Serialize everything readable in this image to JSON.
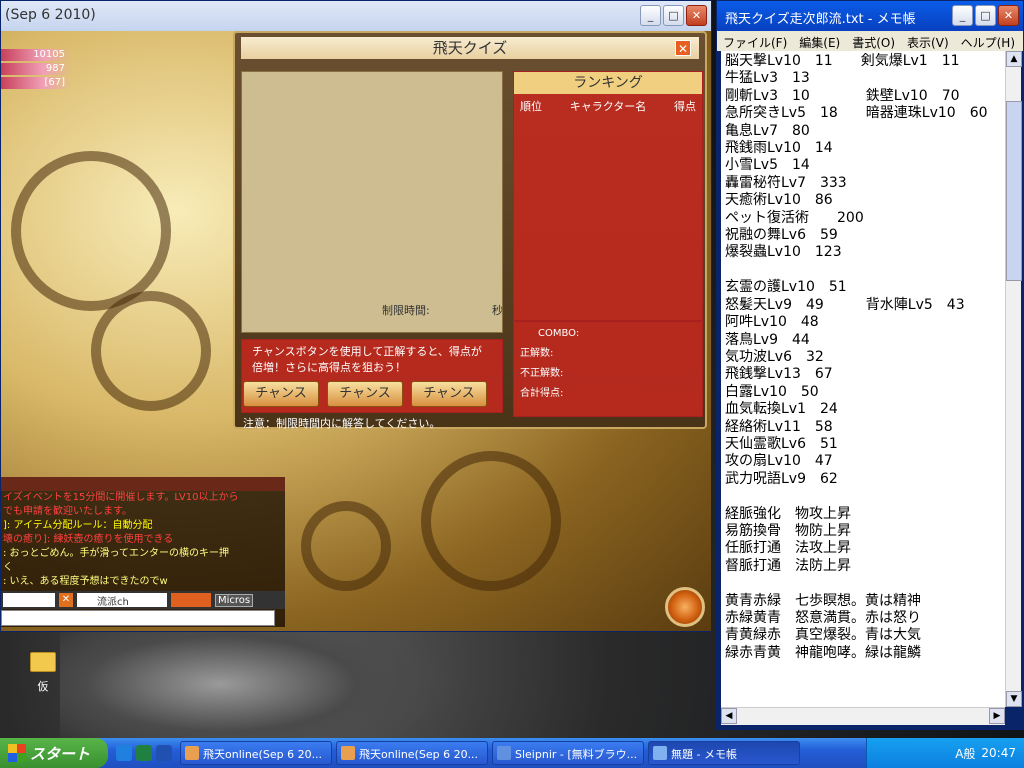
{
  "game": {
    "title": "(Sep  6 2010)",
    "hud": [
      "10105",
      "987",
      "[67]"
    ],
    "quiz": {
      "title": "飛天クイズ",
      "ranking_title": "ランキング",
      "ranking_cols": [
        "順位",
        "キャラクター名",
        "得点"
      ],
      "limit_label": "制限時間:",
      "sec_label": "秒",
      "combo_label": "COMBO:",
      "correct_label": "正解数:",
      "wrong_label": "不正解数:",
      "total_label": "合計得点:",
      "info": "チャンスボタンを使用して正解すると、得点が倍増！さらに高得点を狙おう！",
      "chance_buttons": [
        "チャンス",
        "チャンス",
        "チャンス"
      ],
      "note": "注意：制限時間内に解答してください。"
    },
    "chat": [
      {
        "text": "イズイベントを15分間に開催します。LV10以上から",
        "color": "#ff4040"
      },
      {
        "text": "でも申請を歓迎いたします。",
        "color": "#ff4040"
      },
      {
        "text": "]: アイテム分配ルール：自動分配",
        "color": "#ffff00"
      },
      {
        "text": "壊の癒り]: 練妖壺の癒りを使用できる",
        "color": "#ff4040"
      },
      {
        "text": ": おっとごめん。手が滑ってエンターの横のキー押",
        "color": "#ffff80"
      },
      {
        "text": "く",
        "color": "#ffff80"
      },
      {
        "text": ": いえ、ある程度予想はできたのでw",
        "color": "#ffff80"
      }
    ],
    "channel": "流派ch",
    "micros": "Micros"
  },
  "notepad": {
    "title": "飛天クイズ走次郎流.txt - メモ帳",
    "menu": [
      "ファイル(F)",
      "編集(E)",
      "書式(O)",
      "表示(V)",
      "ヘルプ(H)"
    ],
    "text": "脳天撃Lv10　11　　剣気爆Lv1　11\n牛猛Lv3　13\n剛斬Lv3　10　　　　鉄壁Lv10　70\n急所突きLv5　18　　暗器連珠Lv10　60\n亀息Lv7　80\n飛銭雨Lv10　14\n小雪Lv5　14\n轟雷秘符Lv7　333\n天癒術Lv10　86\nペット復活術　　200\n祝融の舞Lv6　59\n爆裂蟲Lv10　123\n\n玄霊の護Lv10　51\n怒髪天Lv9　49　　　背水陣Lv5　43\n阿吽Lv10　48\n落鳥Lv9　44\n気功波Lv6　32\n飛銭撃Lv13　67\n白露Lv10　50\n血気転換Lv1　24\n経絡術Lv11　58\n天仙霊歌Lv6　51\n攻の扇Lv10　47\n武力呪語Lv9　62\n\n経脈強化　物攻上昇\n易筋換骨　物防上昇\n任脈打通　法攻上昇\n督脈打通　法防上昇\n\n黄青赤緑　七歩瞑想。黄は精神\n赤緑黄青　怒意満貫。赤は怒り\n青黄緑赤　真空爆裂。青は大気\n緑赤青黄　神龍咆哮。緑は龍鱗"
  },
  "desktop": {
    "icon_label": "仮"
  },
  "taskbar": {
    "start": "スタート",
    "tasks": [
      {
        "label": "飛天online(Sep  6 20...",
        "icon_color": "#e8a050"
      },
      {
        "label": "飛天online(Sep  6 20...",
        "icon_color": "#e8a050"
      },
      {
        "label": "Sleipnir - [無料ブラウ...",
        "icon_color": "#6090e0"
      },
      {
        "label": "無題 - メモ帳",
        "icon_color": "#80b0f0"
      }
    ],
    "ime": "A般",
    "time": "20:47"
  }
}
